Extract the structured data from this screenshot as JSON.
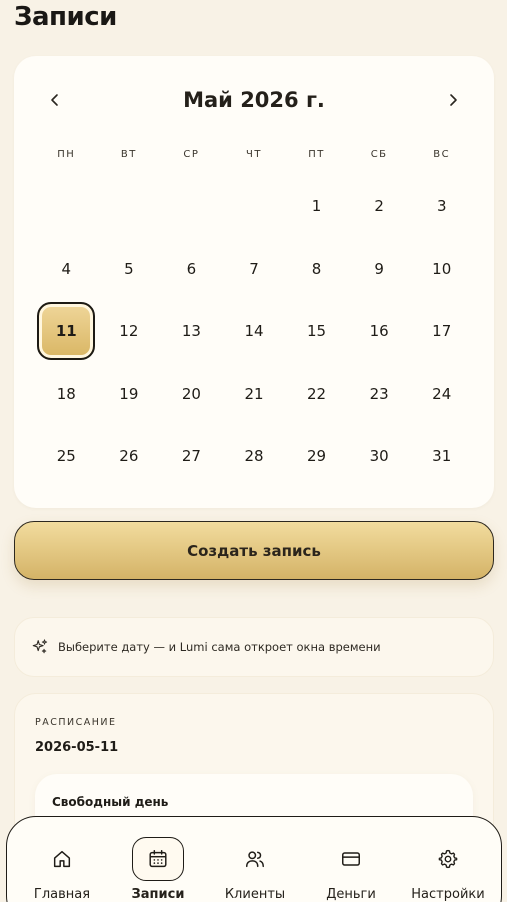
{
  "page": {
    "title": "Записи"
  },
  "calendar": {
    "month_label": "Май 2026 г.",
    "prev_icon": "chevron-left-icon",
    "next_icon": "chevron-right-icon",
    "weekdays": [
      "ПН",
      "ВТ",
      "СР",
      "ЧТ",
      "ПТ",
      "СБ",
      "ВС"
    ],
    "leading_empty": 4,
    "days": [
      "1",
      "2",
      "3",
      "4",
      "5",
      "6",
      "7",
      "8",
      "9",
      "10",
      "11",
      "12",
      "13",
      "14",
      "15",
      "16",
      "17",
      "18",
      "19",
      "20",
      "21",
      "22",
      "23",
      "24",
      "25",
      "26",
      "27",
      "28",
      "29",
      "30",
      "31"
    ],
    "selected_day": "11",
    "accent_color": "#d9b664"
  },
  "actions": {
    "create_label": "Создать запись"
  },
  "hint": {
    "icon": "sparkles-icon",
    "text": "Выберите дату — и Lumi сама откроет окна времени"
  },
  "schedule": {
    "label": "РАСПИСАНИЕ",
    "date": "2026-05-11",
    "slot_title": "Свободный день"
  },
  "nav": {
    "items": [
      {
        "key": "home",
        "label": "Главная",
        "icon": "home-icon"
      },
      {
        "key": "records",
        "label": "Записи",
        "icon": "calendar-icon",
        "active": true
      },
      {
        "key": "clients",
        "label": "Клиенты",
        "icon": "users-icon"
      },
      {
        "key": "money",
        "label": "Деньги",
        "icon": "credit-card-icon"
      },
      {
        "key": "settings",
        "label": "Настройки",
        "icon": "gear-icon"
      }
    ]
  }
}
